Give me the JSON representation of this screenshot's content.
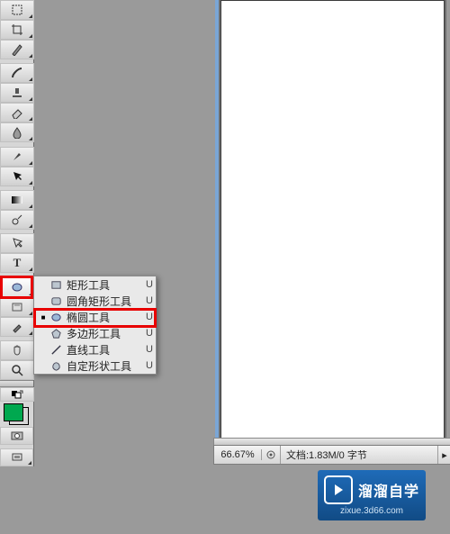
{
  "flyout": {
    "items": [
      {
        "label": "矩形工具",
        "shortcut": "U"
      },
      {
        "label": "圆角矩形工具",
        "shortcut": "U"
      },
      {
        "label": "椭圆工具",
        "shortcut": "U"
      },
      {
        "label": "多边形工具",
        "shortcut": "U"
      },
      {
        "label": "直线工具",
        "shortcut": "U"
      },
      {
        "label": "自定形状工具",
        "shortcut": "U"
      }
    ]
  },
  "status": {
    "zoom": "66.67%",
    "doc": "文档:1.83M/0 字节"
  },
  "badge": {
    "title": "溜溜自学",
    "url": "zixue.3d66.com"
  },
  "colors": {
    "fg": "#00a84f",
    "bg": "#ffffff"
  }
}
